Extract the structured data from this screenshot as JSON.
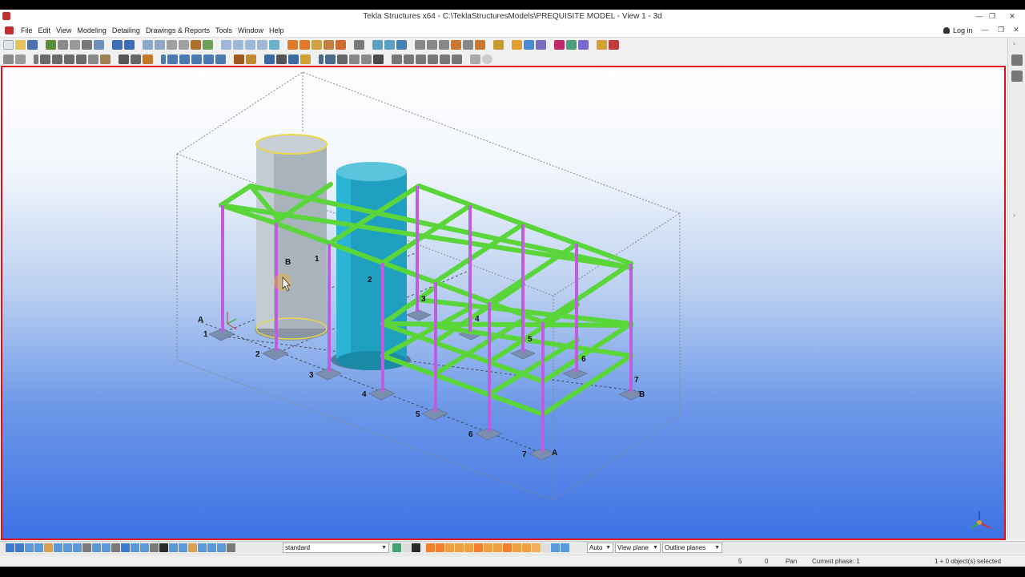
{
  "window": {
    "title": "Tekla Structures x64 - C:\\TeklaStructuresModels\\PREQUISITE MODEL  - View 1 - 3d",
    "controls": {
      "minimize": "—",
      "restore": "❐",
      "close": "✕"
    }
  },
  "menu": {
    "items": [
      "File",
      "Edit",
      "View",
      "Modeling",
      "Detailing",
      "Drawings & Reports",
      "Tools",
      "Window",
      "Help"
    ],
    "login_label": "Log in",
    "controls": {
      "minimize": "—",
      "restore": "❐",
      "close": "✕"
    }
  },
  "bottom_toolbar": {
    "filter_select": "standard",
    "snap_select": "Auto",
    "plane_select": "View plane",
    "outline_select": "Outline planes"
  },
  "status": {
    "value_1": "5",
    "value_2": "0",
    "mode": "Pan",
    "phase": "Current phase: 1",
    "selection": "1 + 0 object(s) selected"
  },
  "model": {
    "tank_labels": [
      "B",
      "1",
      "2"
    ],
    "grid_near": [
      "A",
      "1",
      "2",
      "3",
      "4",
      "5",
      "6",
      "7",
      "A"
    ],
    "grid_far": [
      "3",
      "4",
      "5",
      "6",
      "7",
      "B"
    ]
  },
  "colors": {
    "viewport_border": "#e3101a",
    "beam": "#5bd63a",
    "column": "#c05ce0",
    "tank_grey": "#a9b3bc",
    "tank_blue": "#1fa0c0"
  }
}
